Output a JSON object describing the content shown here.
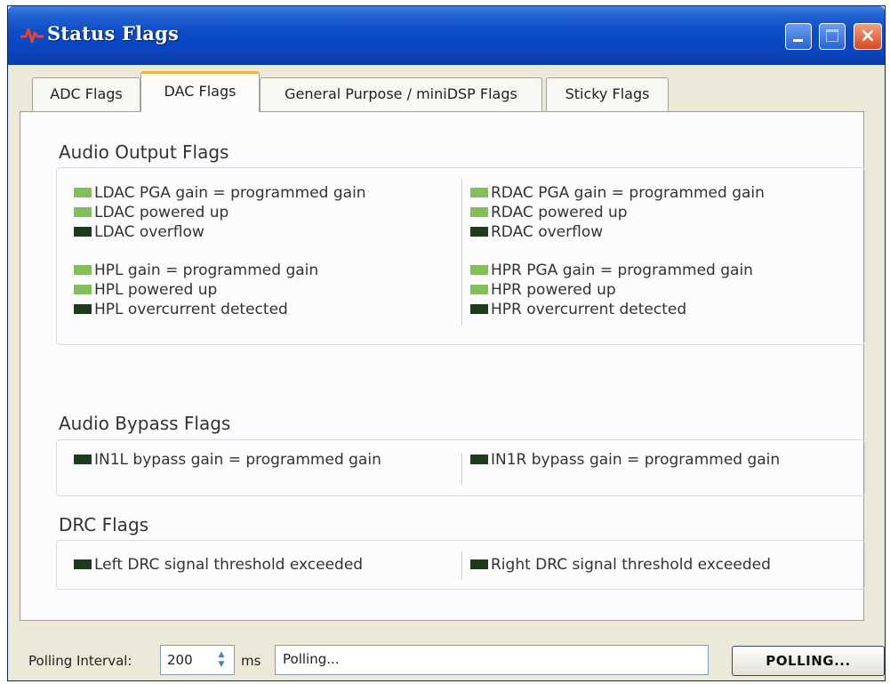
{
  "window": {
    "title": "Status Flags",
    "app_icon": "ti-logo-icon",
    "buttons": {
      "minimize": "minimize-icon",
      "maximize": "maximize-icon",
      "close": "×"
    }
  },
  "tabs": [
    {
      "label": "ADC Flags",
      "active": false
    },
    {
      "label": "DAC Flags",
      "active": true
    },
    {
      "label": "General Purpose / miniDSP Flags",
      "active": false
    },
    {
      "label": "Sticky Flags",
      "active": false
    }
  ],
  "colors": {
    "led_on": "#82bf5a",
    "led_off": "#1d3b1a",
    "active_tab_accent": "#f4b33d"
  },
  "sections": {
    "audio_output": {
      "title": "Audio Output Flags",
      "left": [
        {
          "label": "LDAC PGA gain = programmed gain",
          "state": "on"
        },
        {
          "label": "LDAC powered up",
          "state": "on"
        },
        {
          "label": "LDAC overflow",
          "state": "off"
        },
        {
          "label": "HPL gain = programmed gain",
          "state": "on"
        },
        {
          "label": "HPL powered up",
          "state": "on"
        },
        {
          "label": "HPL overcurrent detected",
          "state": "off"
        }
      ],
      "right": [
        {
          "label": "RDAC PGA gain = programmed gain",
          "state": "on"
        },
        {
          "label": "RDAC powered up",
          "state": "on"
        },
        {
          "label": "RDAC overflow",
          "state": "off"
        },
        {
          "label": "HPR PGA gain = programmed gain",
          "state": "on"
        },
        {
          "label": "HPR powered up",
          "state": "on"
        },
        {
          "label": "HPR overcurrent detected",
          "state": "off"
        }
      ]
    },
    "audio_bypass": {
      "title": "Audio Bypass Flags",
      "left": [
        {
          "label": "IN1L bypass gain = programmed gain",
          "state": "off"
        }
      ],
      "right": [
        {
          "label": "IN1R bypass gain = programmed gain",
          "state": "off"
        }
      ]
    },
    "drc": {
      "title": "DRC Flags",
      "left": [
        {
          "label": "Left DRC signal threshold exceeded",
          "state": "off"
        }
      ],
      "right": [
        {
          "label": "Right DRC signal threshold exceeded",
          "state": "off"
        }
      ]
    }
  },
  "statusbar": {
    "polling_interval_label": "Polling Interval:",
    "polling_interval_value": "200",
    "unit": "ms",
    "status_text": "Polling...",
    "polling_button": "POLLING..."
  }
}
